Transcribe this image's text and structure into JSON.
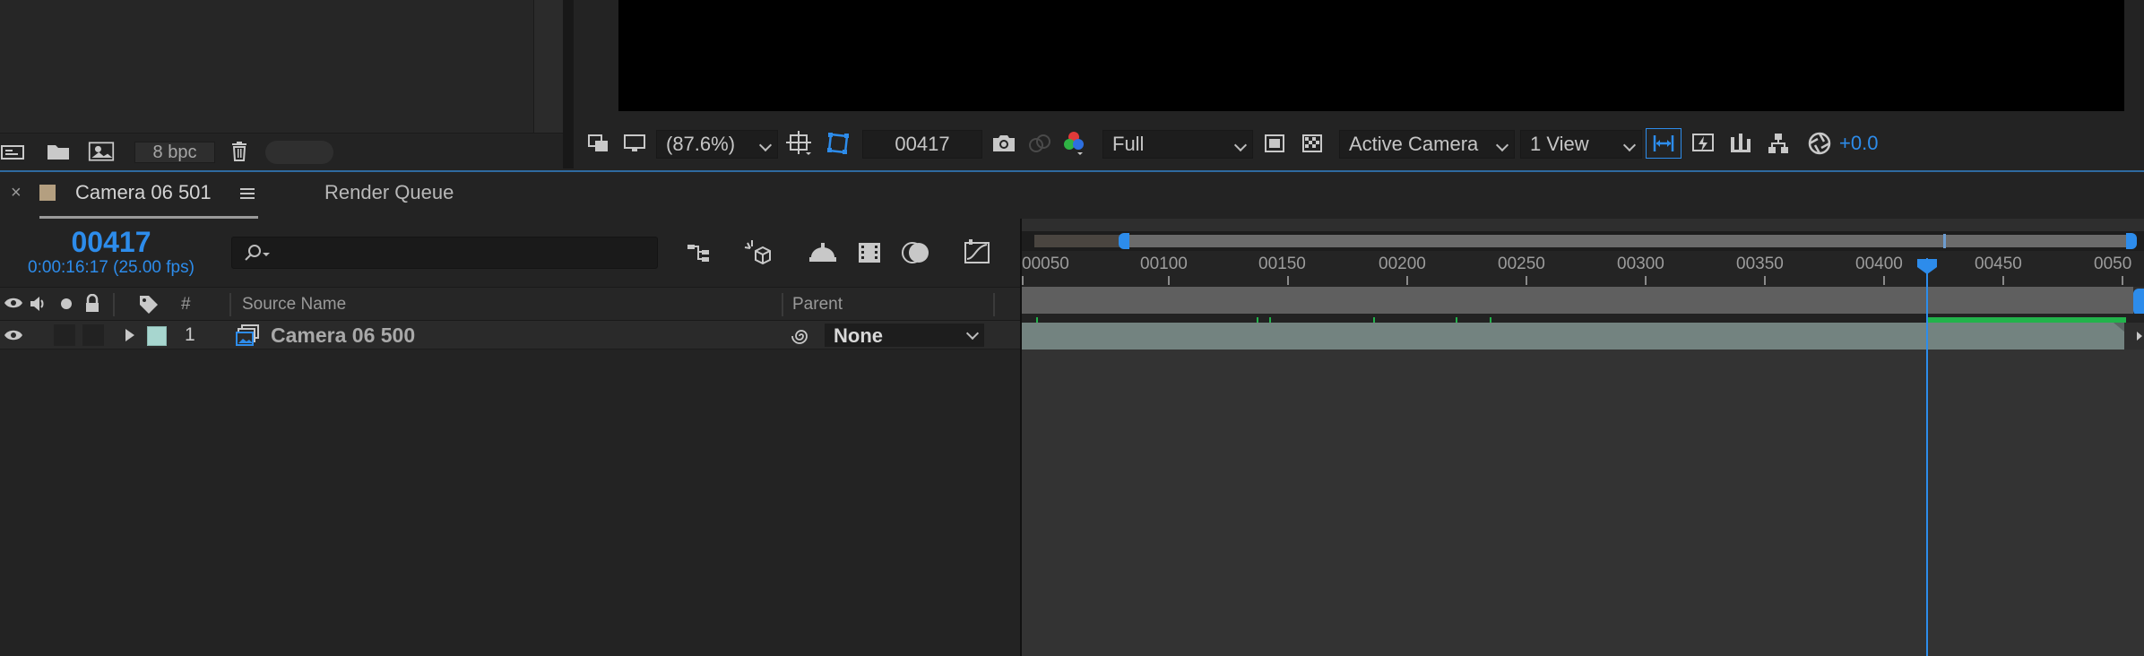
{
  "project_footer": {
    "bpc_label": "8 bpc",
    "icons": [
      "interpret-footage-icon",
      "new-folder-icon",
      "new-composition-icon",
      "trash-icon"
    ]
  },
  "viewer_toolbar": {
    "zoom": "(87.6%)",
    "current_frame": "00417",
    "resolution": "Full",
    "camera": "Active Camera",
    "views": "1 View",
    "exposure": "+0.0",
    "accent_color": "#2d8ceb"
  },
  "tabs": {
    "active": "Camera 06 501",
    "render_queue": "Render Queue",
    "swatch_color": "#b49f80"
  },
  "comp": {
    "timecode": "00417",
    "timecode_sub": "0:00:16:17 (25.00 fps)"
  },
  "columns": {
    "number": "#",
    "source_name": "Source Name",
    "parent": "Parent"
  },
  "layer": {
    "index": "1",
    "name": "Camera 06 500",
    "parent": "None",
    "label_color": "#a7d6cf"
  },
  "ruler": {
    "ticks": [
      "00050",
      "00100",
      "00150",
      "00200",
      "00250",
      "00300",
      "00350",
      "00400",
      "00450",
      "0050"
    ]
  }
}
